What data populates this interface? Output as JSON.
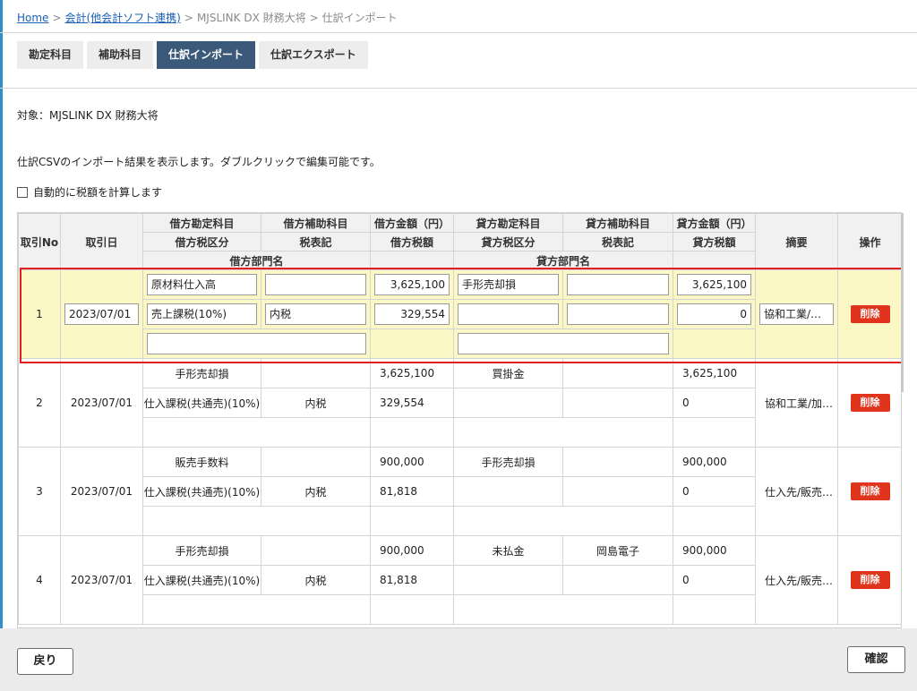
{
  "breadcrumb": {
    "home": "Home",
    "accounting": "会計(他会計ソフト連携)",
    "product": "MJSLINK DX 財務大将",
    "current": "仕訳インポート",
    "sep": ">"
  },
  "tabs": [
    {
      "label": "勘定科目"
    },
    {
      "label": "補助科目"
    },
    {
      "label": "仕訳インポート"
    },
    {
      "label": "仕訳エクスポート"
    }
  ],
  "target_text": "対象：MJSLINK DX 財務大将",
  "description": "仕訳CSVのインポート結果を表示します。ダブルクリックで編集可能です。",
  "auto_calc_label": "自動的に税額を計算します",
  "headers": {
    "no": "取引No",
    "date": "取引日",
    "debit_account": "借方勘定科目",
    "debit_sub": "借方補助科目",
    "debit_amount": "借方金額（円）",
    "credit_account": "貸方勘定科目",
    "credit_sub": "貸方補助科目",
    "credit_amount": "貸方金額（円）",
    "debit_tax_class": "借方税区分",
    "tax_notation": "税表記",
    "debit_tax": "借方税額",
    "credit_tax_class": "貸方税区分",
    "tax_notation2": "税表記",
    "credit_tax": "貸方税額",
    "memo": "摘要",
    "action": "操作",
    "debit_dept": "借方部門名",
    "credit_dept": "貸方部門名"
  },
  "rows": [
    {
      "no": "1",
      "date": "2023/07/01",
      "debit_account": "原材料仕入高",
      "debit_sub": "",
      "debit_amount": "3,625,100",
      "credit_account": "手形売却損",
      "credit_sub": "",
      "credit_amount": "3,625,100",
      "debit_tax_class": "売上課税(10%)",
      "debit_tax_notation": "内税",
      "debit_tax": "329,554",
      "credit_tax_class": "",
      "credit_tax_notation": "",
      "credit_tax": "0",
      "memo": "協和工業/…",
      "debit_dept": "",
      "credit_dept": "",
      "delete": "削除"
    },
    {
      "no": "2",
      "date": "2023/07/01",
      "debit_account": "手形売却損",
      "debit_sub": "",
      "debit_amount": "3,625,100",
      "credit_account": "買掛金",
      "credit_sub": "",
      "credit_amount": "3,625,100",
      "debit_tax_class": "仕入課税(共通売)(10%)",
      "debit_tax_notation": "内税",
      "debit_tax": "329,554",
      "credit_tax_class": "",
      "credit_tax_notation": "",
      "credit_tax": "0",
      "memo": "協和工業/加…",
      "debit_dept": "",
      "credit_dept": "",
      "delete": "削除"
    },
    {
      "no": "3",
      "date": "2023/07/01",
      "debit_account": "販売手数料",
      "debit_sub": "",
      "debit_amount": "900,000",
      "credit_account": "手形売却損",
      "credit_sub": "",
      "credit_amount": "900,000",
      "debit_tax_class": "仕入課税(共通売)(10%)",
      "debit_tax_notation": "内税",
      "debit_tax": "81,818",
      "credit_tax_class": "",
      "credit_tax_notation": "",
      "credit_tax": "0",
      "memo": "仕入先/販売…",
      "debit_dept": "",
      "credit_dept": "",
      "delete": "削除"
    },
    {
      "no": "4",
      "date": "2023/07/01",
      "debit_account": "手形売却損",
      "debit_sub": "",
      "debit_amount": "900,000",
      "credit_account": "未払金",
      "credit_sub": "岡島電子",
      "credit_amount": "900,000",
      "debit_tax_class": "仕入課税(共通売)(10%)",
      "debit_tax_notation": "内税",
      "debit_tax": "81,818",
      "credit_tax_class": "",
      "credit_tax_notation": "",
      "credit_tax": "0",
      "memo": "仕入先/販売…",
      "debit_dept": "",
      "credit_dept": "",
      "delete": "削除"
    }
  ],
  "footer": {
    "back": "戻り",
    "confirm": "確認"
  }
}
